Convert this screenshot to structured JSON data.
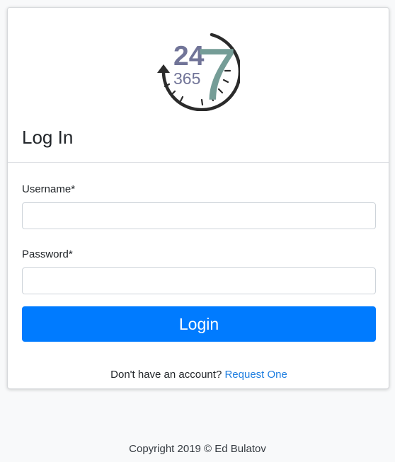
{
  "logo": {
    "number_top": "24",
    "number_bottom": "365",
    "number_large": "7",
    "icon": "clock-arrow-icon",
    "colors": {
      "purple": "#717498",
      "teal": "#759d97",
      "dark": "#2b2b2b"
    }
  },
  "login_card": {
    "title": "Log In",
    "username_label": "Username*",
    "username_value": "",
    "password_label": "Password*",
    "password_value": "",
    "login_button": "Login",
    "signup_prompt": "Don't have an account?",
    "signup_link": "Request One"
  },
  "footer": {
    "copyright": "Copyright 2019 © Ed Bulatov"
  },
  "colors": {
    "primary": "#007bff",
    "link": "#1e7ee0",
    "background": "#f8f9fa"
  }
}
